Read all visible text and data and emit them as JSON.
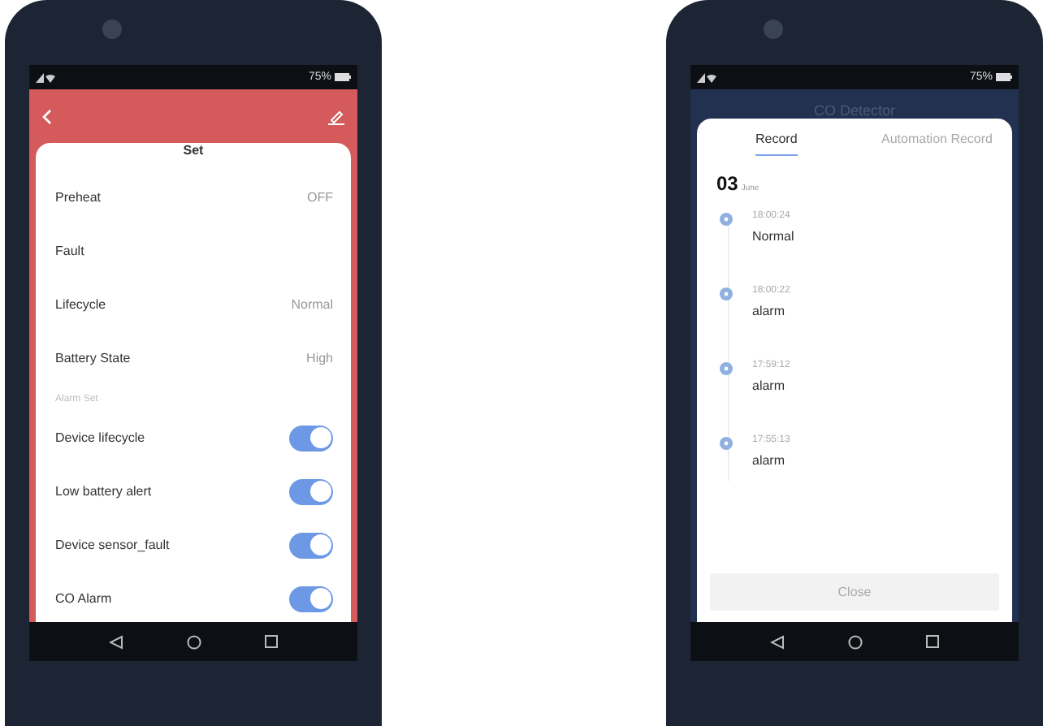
{
  "settings_phone": {
    "status_bar": {
      "battery": "75%"
    },
    "sheet_title": "Set",
    "info_rows": [
      {
        "label": "Preheat",
        "value": "OFF"
      },
      {
        "label": "Fault"
      },
      {
        "label": "Lifecycle",
        "value": "Normal"
      },
      {
        "label": "Battery State",
        "value": "High"
      }
    ],
    "section_label": "Alarm Set",
    "toggles": [
      {
        "label": "Device lifecycle",
        "on": true
      },
      {
        "label": "Low battery alert",
        "on": true
      },
      {
        "label": "Device sensor_fault",
        "on": true
      },
      {
        "label": "CO Alarm",
        "on": true
      }
    ]
  },
  "record_phone": {
    "status_bar": {
      "battery": "75%"
    },
    "header_title": "CO Detector",
    "tabs": [
      {
        "label": "Record",
        "selected": true
      },
      {
        "label": "Automation Record",
        "selected": false
      }
    ],
    "date": {
      "day": "03",
      "month": "June"
    },
    "events": [
      {
        "time": "18:00:24",
        "event": "Normal"
      },
      {
        "time": "18:00:22",
        "event": "alarm"
      },
      {
        "time": "17:59:12",
        "event": "alarm"
      },
      {
        "time": "17:55:13",
        "event": "alarm"
      }
    ],
    "close_button": "Close"
  }
}
